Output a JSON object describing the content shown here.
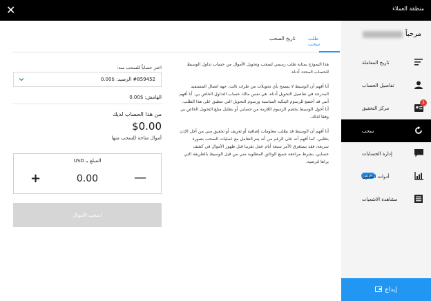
{
  "window": {
    "title": "منطقة العملاء",
    "close_symbol": "✕"
  },
  "sidebar": {
    "greeting": "مرحباً",
    "items": [
      {
        "label": "تاريخ المعاملة",
        "icon": "sort-lines-icon"
      },
      {
        "label": "تفاصيل الحساب",
        "icon": "person-icon"
      },
      {
        "label": "مركز التحقيق",
        "icon": "id-card-icon",
        "badge": "1"
      },
      {
        "label": "سحب",
        "icon": "refresh-icon",
        "active": true
      },
      {
        "label": "إدارة الحسابات",
        "icon": "chat-bubble-icon"
      },
      {
        "label": "أدوات التداول",
        "icon": "chart-icon",
        "tag": "جديد"
      },
      {
        "label": "مشاهدة الاشعيات",
        "icon": "list-icon"
      }
    ],
    "deposit_label": "إيداع"
  },
  "tabs": [
    {
      "label": "طلب سحب",
      "active": true
    },
    {
      "label": "تاريخ السحب",
      "active": false
    }
  ],
  "info": {
    "p1": "هذا النموذج بمثابة طلب رسمي لسحب وتحويل الأموال من حساب تداول الوسيط للحساب المحدد أدناه.",
    "p2": "أنا أفهم أن الوسيط لا يسمح بأي تحويلات من طرف ثالث. جهة اتصال المستفيد المدرجة في تفاصيل التحويل أدناه، هي نفس مالك حساب التداول الخاص بي. أنا أفهم أنني قد أخضع للرسوم البنكية المناسبة ورسوم التحويل التي تنطبق على هذا الطلب. أنا أخول الوسيط بخصم الرسوم اللازمة من حسابي أو بتقليل مبلغ التحويل الخاص بي وفقا لذلك.",
    "p3": "أنا أفهم أن الوسيط قد يطلب معلومات إضافية أو تعريف أو تحقيق مني من أجل الإذن بطلبي. كما أفهم أنه على الرغم من أنه يتم التعامل مع عمليات السحب بصورة سريعة، فقد يستغرق الأمر سبعة أيام عمل تقريبا قبل ظهور الأموال في كشف حسابي، بشرط مراجعة جميع الوثائق المطلوبة مني من قبل الوسيط بالطريقة التي يراها مُرضية."
  },
  "form": {
    "account_label": "اختر حساباً للسحب منه:",
    "account_value": "#859452 الرصيد: $0.00",
    "margin_text": "الهامش: $0.00",
    "available_title": "من هذا الحساب لديك",
    "available_amount": "$0.00",
    "available_sub": "أموال متاحة للسحب منها",
    "amount_label": "المبلغ بـ USD",
    "amount_value": "0.00",
    "plus": "+",
    "minus": "—",
    "withdraw_button": "اسحب الأموال"
  },
  "colors": {
    "accent": "#2196f3",
    "topbar": "#000000",
    "sidebar_bg": "#f4f4f4",
    "disabled": "#d6d6d6"
  }
}
